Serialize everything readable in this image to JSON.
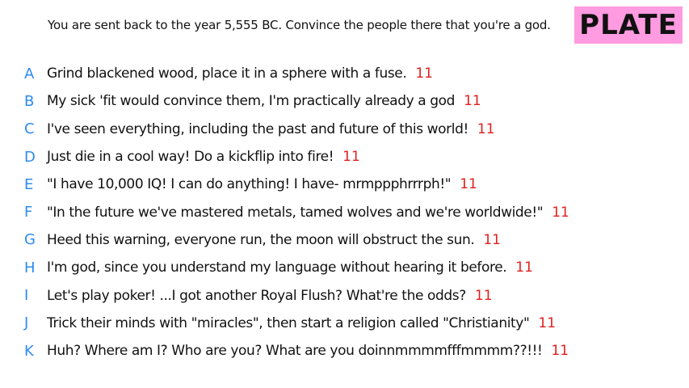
{
  "prompt": "You are sent back to the year 5,555 BC. Convince the people there that you're a god.",
  "badge": {
    "label": "PLATE",
    "color": "#ff9be0"
  },
  "colors": {
    "letter": "#2c8cf0",
    "score": "#e02020",
    "text": "#111111"
  },
  "options": [
    {
      "letter": "A",
      "text": "Grind blackened wood, place it in a sphere with a fuse.",
      "score": "11"
    },
    {
      "letter": "B",
      "text": "My sick 'fit would convince them, I'm practically already a god",
      "score": "11"
    },
    {
      "letter": "C",
      "text": "I've seen everything, including the past and future of this world!",
      "score": "11"
    },
    {
      "letter": "D",
      "text": "Just die in a cool way! Do a kickflip into fire!",
      "score": "11"
    },
    {
      "letter": "E",
      "text": "\"I have 10,000 IQ! I can do anything! I have- mrmppphrrrph!\"",
      "score": "11"
    },
    {
      "letter": "F",
      "text": "\"In the future we've mastered metals, tamed wolves and we're worldwide!\"",
      "score": "11"
    },
    {
      "letter": "G",
      "text": "Heed this warning, everyone run, the moon will obstruct the sun.",
      "score": "11"
    },
    {
      "letter": "H",
      "text": "I'm god, since you understand my language without hearing it before.",
      "score": "11"
    },
    {
      "letter": "I",
      "text": "Let's play poker! ...I got another Royal Flush? What're the odds?",
      "score": "11"
    },
    {
      "letter": "J",
      "text": "Trick their minds with \"miracles\", then start a religion called \"Christianity\"",
      "score": "11"
    },
    {
      "letter": "K",
      "text": "Huh? Where am I? Who are you? What are you doinnmmmmfffmmmm??!!!",
      "score": "11"
    }
  ]
}
